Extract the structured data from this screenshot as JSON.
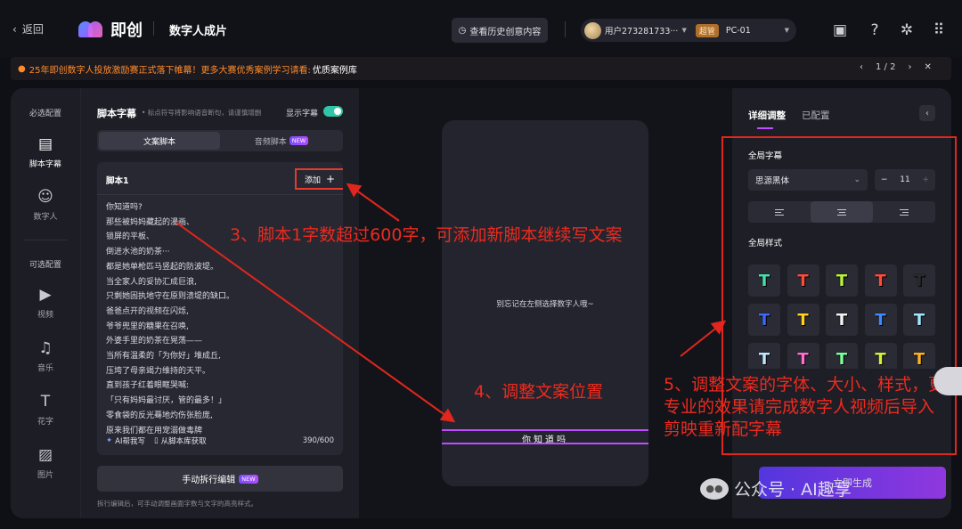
{
  "topbar": {
    "back_label": "返回",
    "app_name": "即创",
    "page_title": "数字人成片",
    "history_button": "查看历史创意内容",
    "user_name": "用户273281733···",
    "role_badge": "超管",
    "org": "PC-01"
  },
  "banner": {
    "text": "25年即创数字人投放激励赛正式落下帷幕！更多大赛优秀案例学习请看:",
    "link": "优质案例库",
    "pager": "1 / 2"
  },
  "leftnav": {
    "required_label": "必选配置",
    "optional_label": "可选配置",
    "items": [
      {
        "label": "脚本字幕"
      },
      {
        "label": "数字人"
      },
      {
        "label": "视频"
      },
      {
        "label": "音乐"
      },
      {
        "label": "花字"
      },
      {
        "label": "图片"
      }
    ]
  },
  "script_panel": {
    "title": "脚本字幕",
    "hint": "• 标点符号将影响语音断句，请谨慎增删",
    "show_subtitles": "显示字幕",
    "tab_text": "文案脚本",
    "tab_audio": "音频脚本",
    "new_badge": "NEW",
    "script_title": "脚本1",
    "add_label": "添加",
    "lines": [
      "你知道吗?",
      "那些被妈妈藏起的漫画、",
      "锁屏的平板、",
      "倒进水池的奶茶···",
      "都是她单枪匹马竖起的防波堤。",
      "当全家人的妥协汇成巨浪,",
      "只剩她固执地守在原则溃堤的缺口。",
      "爸爸点开的视频在闪烁,",
      "爷爷兜里的糖果在召唤,",
      "外婆手里的奶茶在晃荡——",
      "当所有温柔的「为你好」堆成丘,",
      "压垮了母亲竭力维持的天平。",
      "直到孩子红着眼眶哭喊:",
      "「只有妈妈最讨厌，管的最多！」",
      "零食袋的反光蓦地灼伤张脸庞,",
      "原来我们都在用宠溺做毒牌"
    ],
    "ai_help": "AI帮我写",
    "from_library": "从脚本库获取",
    "count": "390/600",
    "manual_button": "手动拆行编辑",
    "manual_badge": "NEW",
    "foot_hint": "拆行编辑后，可手动调整画面字数与文字的高亮样式。"
  },
  "preview": {
    "message": "别忘记在左侧选择数字人哦~",
    "subtitle": "你知道吗"
  },
  "settings": {
    "tab_detail": "详细调整",
    "tab_configured": "已配置",
    "global_subtitle_label": "全局字幕",
    "font": "思源黑体",
    "font_size": "11",
    "global_style_label": "全局样式",
    "styles": [
      {
        "glyph": "T",
        "color": "#46e0b0"
      },
      {
        "glyph": "T",
        "color": "#ff4b3a"
      },
      {
        "glyph": "T",
        "color": "#b9f23a"
      },
      {
        "glyph": "T",
        "color": "#ff4b3a"
      },
      {
        "glyph": "T",
        "color": "#2a2a2a"
      },
      {
        "glyph": "T",
        "color": "#3f66ff"
      },
      {
        "glyph": "T",
        "color": "#ffd21f"
      },
      {
        "glyph": "T",
        "color": "#f2f2f2"
      },
      {
        "glyph": "T",
        "color": "#3d8bff"
      },
      {
        "glyph": "T",
        "color": "#9ee7ff"
      },
      {
        "glyph": "T",
        "color": "#bfe8ff"
      },
      {
        "glyph": "T",
        "color": "#ff6fd0"
      },
      {
        "glyph": "T",
        "color": "#7aff9a"
      },
      {
        "glyph": "T",
        "color": "#d6f03a"
      },
      {
        "glyph": "T",
        "color": "#ffb21f"
      }
    ],
    "generate_button": "立即生成"
  },
  "annotations": {
    "a3": "3、脚本1字数超过600字，可添加新脚本继续写文案",
    "a4": "4、调整文案位置",
    "a5": "5、调整文案的字体、大小、样式，更专业的效果请完成数字人视频后导入剪映重新配字幕"
  },
  "watermark": {
    "text": "公众号 · AI趣享"
  }
}
